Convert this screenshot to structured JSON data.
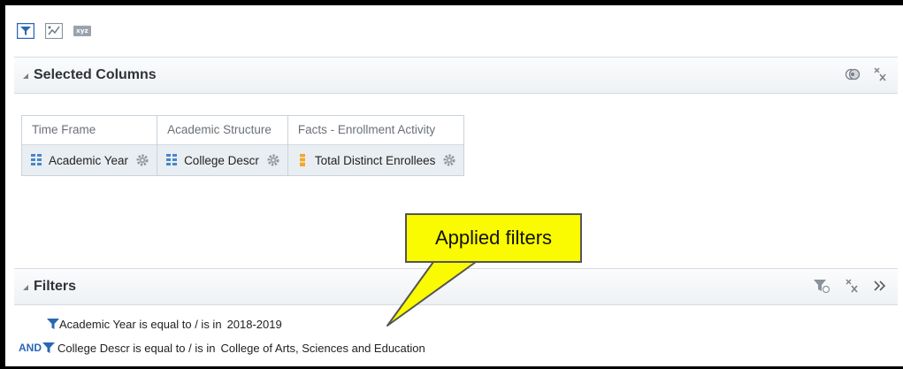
{
  "toolbar": {
    "icons": [
      "filter-icon",
      "chart-icon",
      "xyz-icon"
    ],
    "xyz_label": "xyz"
  },
  "selected_columns": {
    "title": "Selected Columns",
    "columns": [
      {
        "folder": "Time Frame",
        "item": "Academic Year",
        "icon": "attribute-icon"
      },
      {
        "folder": "Academic Structure",
        "item": "College Descr",
        "icon": "attribute-icon"
      },
      {
        "folder": "Facts - Enrollment Activity",
        "item": "Total Distinct Enrollees",
        "icon": "measure-icon"
      }
    ]
  },
  "filters": {
    "title": "Filters",
    "items": [
      {
        "prefix": "",
        "text": "Academic Year is equal to / is in",
        "value": "2018-2019"
      },
      {
        "prefix": "AND",
        "text": "College Descr is equal to / is in",
        "value": "College of Arts, Sciences and Education"
      }
    ]
  },
  "callout": {
    "text": "Applied filters"
  },
  "colors": {
    "accent_blue": "#2a67b5",
    "callout_yellow": "#fafa00",
    "measure_orange": "#f0a830"
  }
}
